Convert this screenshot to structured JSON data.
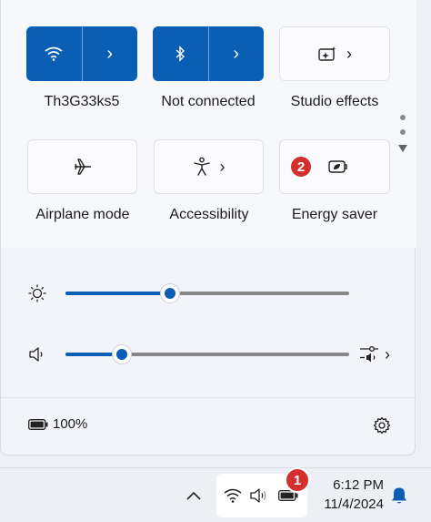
{
  "quick_settings": {
    "tiles": [
      {
        "label": "Th3G33ks5",
        "icon": "wifi-icon",
        "state": "on",
        "has_chevron": true
      },
      {
        "label": "Not connected",
        "icon": "bluetooth-icon",
        "state": "on",
        "has_chevron": true
      },
      {
        "label": "Studio effects",
        "icon": "studio-effects-icon",
        "state": "off",
        "has_chevron": true
      },
      {
        "label": "Airplane mode",
        "icon": "airplane-icon",
        "state": "off",
        "has_chevron": false
      },
      {
        "label": "Accessibility",
        "icon": "accessibility-icon",
        "state": "off",
        "has_chevron": true
      },
      {
        "label": "Energy saver",
        "icon": "energy-saver-icon",
        "state": "off",
        "has_chevron": false
      }
    ],
    "page_indicator": {
      "pages": 2,
      "current": 1
    },
    "brightness": {
      "icon": "brightness-icon",
      "level": 0.37
    },
    "volume": {
      "icon": "speaker-icon",
      "level": 0.2,
      "mixer_icon": "audio-mixer-icon"
    },
    "battery": {
      "icon": "battery-icon",
      "text": "100%"
    },
    "settings_icon": "gear-icon"
  },
  "annotations": {
    "badge_1": "1",
    "badge_2": "2"
  },
  "taskbar": {
    "overflow_icon": "chevron-up-icon",
    "tray_icons": [
      "wifi-icon",
      "speaker-icon",
      "battery-icon"
    ],
    "time": "6:12 PM",
    "date": "11/4/2024",
    "notification_icon": "bell-icon"
  },
  "colors": {
    "accent": "#0a5fb5",
    "badge": "#d32f2f"
  }
}
